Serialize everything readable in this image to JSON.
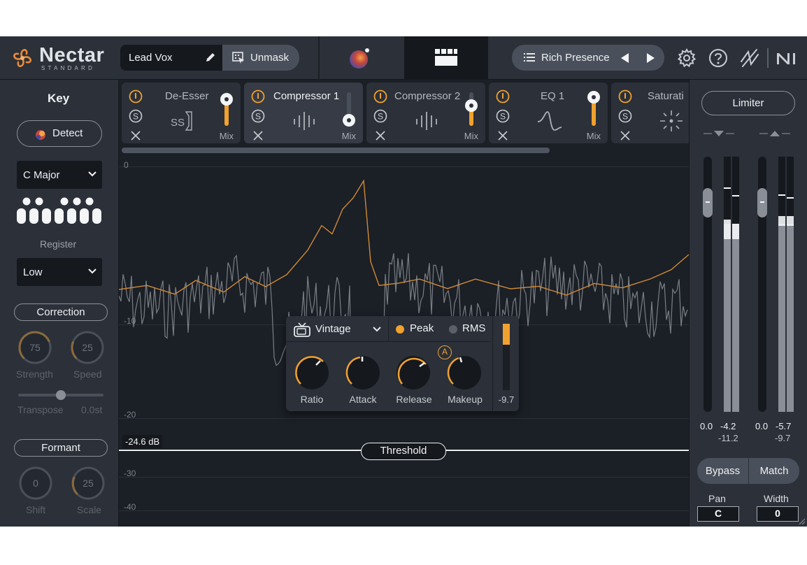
{
  "header": {
    "product_name": "Nectar",
    "product_edition": "STANDARD",
    "preset_name": "Lead Vox",
    "unmask_label": "Unmask",
    "assistant_preset": "Rich Presence"
  },
  "key_panel": {
    "title": "Key",
    "detect_label": "Detect",
    "key_value": "C Major",
    "register_label": "Register",
    "register_value": "Low"
  },
  "correction": {
    "title": "Correction",
    "strength_value": "75",
    "strength_label": "Strength",
    "strength_level": 0.75,
    "speed_value": "25",
    "speed_label": "Speed",
    "speed_level": 0.25,
    "transpose_label": "Transpose",
    "transpose_value": "0.0st"
  },
  "formant": {
    "title": "Formant",
    "shift_value": "0",
    "shift_label": "Shift",
    "scale_value": "25",
    "scale_label": "Scale"
  },
  "modules": [
    {
      "title": "De-Esser",
      "mix_label": "Mix",
      "mix_level": 0.82,
      "active": false
    },
    {
      "title": "Compressor 1",
      "mix_label": "Mix",
      "mix_level": 0.18,
      "active": true
    },
    {
      "title": "Compressor 2",
      "mix_label": "Mix",
      "mix_level": 0.62,
      "active": false
    },
    {
      "title": "EQ 1",
      "mix_label": "Mix",
      "mix_level": 0.88,
      "active": false
    },
    {
      "title": "Saturati",
      "mix_label": "Mix",
      "mix_level": 0.5,
      "active": false
    }
  ],
  "graph": {
    "db_labels": [
      "0",
      "-10",
      "-20",
      "-30",
      "-40"
    ],
    "threshold_value": "-24.6 dB",
    "threshold_label": "Threshold"
  },
  "compressor": {
    "mode": "Vintage",
    "detection_peak": "Peak",
    "detection_rms": "RMS",
    "detection_selected": "Peak",
    "ratio_label": "Ratio",
    "attack_label": "Attack",
    "release_label": "Release",
    "makeup_label": "Makeup",
    "makeup_auto_badge": "A",
    "gain_reduction_value": "-9.7"
  },
  "limiter": {
    "label": "Limiter",
    "input_gain_value": "0.0",
    "input_peak_value": "-4.2",
    "input_rms_value": "-11.2",
    "output_gain_value": "0.0",
    "output_peak_value": "-5.7",
    "output_rms_value": "-9.7"
  },
  "output": {
    "bypass_label": "Bypass",
    "match_label": "Match",
    "pan_label": "Pan",
    "pan_value": "C",
    "width_label": "Width",
    "width_value": "0"
  },
  "colors": {
    "accent": "#f0a12f",
    "panel": "#2b3039",
    "background": "#1b1f26"
  },
  "icons": {
    "power": "power-icon",
    "solo": "solo-icon",
    "remove": "close-icon",
    "settings": "gear-icon",
    "help": "help-icon",
    "plugin_doctor": "signal-icon",
    "brand": "ni-logo-icon"
  }
}
